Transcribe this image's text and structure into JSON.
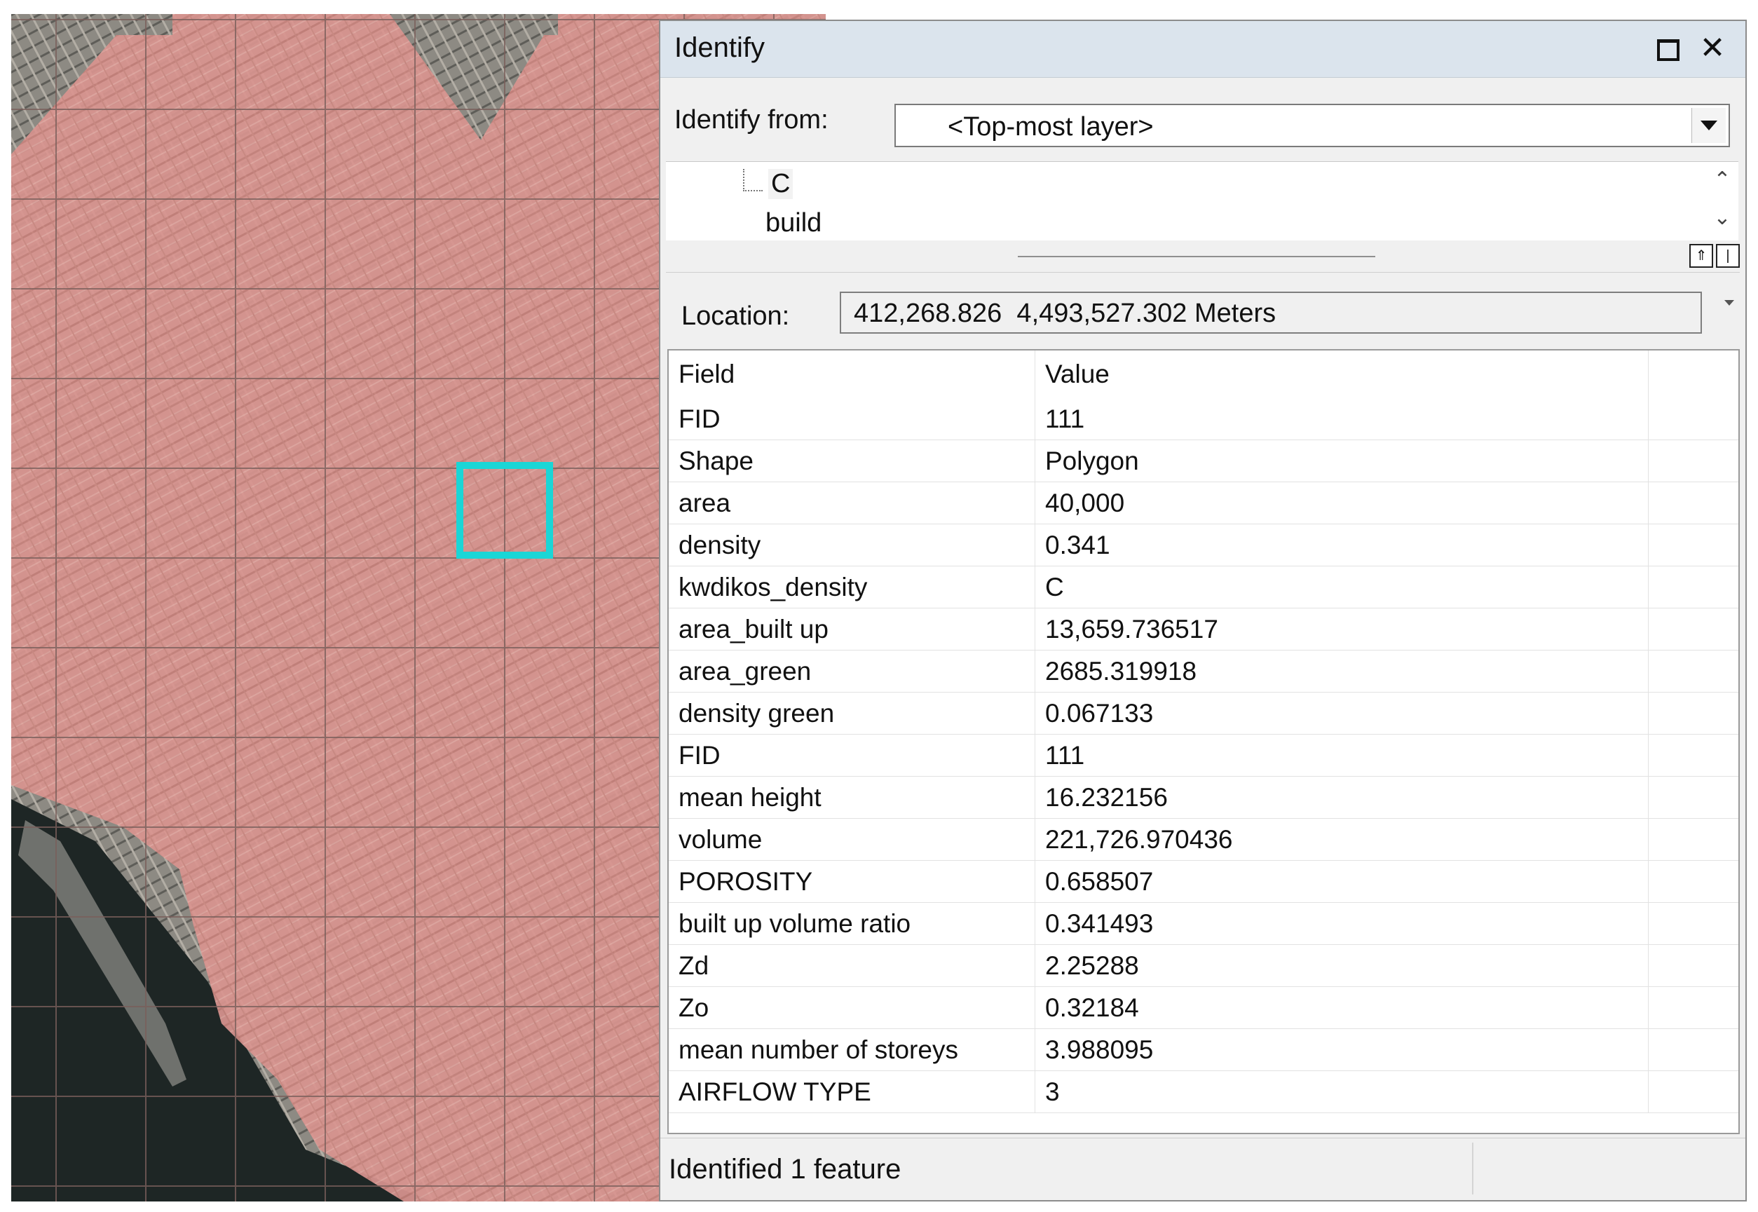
{
  "window": {
    "title": "Identify",
    "close_glyph": "✕",
    "maximize_icon": "maximize-icon",
    "close_icon": "close-icon"
  },
  "identify_from": {
    "label": "Identify from:",
    "value": "<Top-most layer>"
  },
  "tree": {
    "items": [
      "C",
      "build"
    ],
    "scroll_up_glyph": "⌃",
    "scroll_down_glyph": "⌄"
  },
  "mini_buttons": [
    "⇑",
    "|"
  ],
  "location": {
    "label": "Location:",
    "value": "412,268.826  4,493,527.302 Meters"
  },
  "table": {
    "columns": [
      "Field",
      "Value"
    ],
    "rows": [
      {
        "field": "FID",
        "value": "111"
      },
      {
        "field": "Shape",
        "value": "Polygon"
      },
      {
        "field": "area",
        "value": "40,000"
      },
      {
        "field": "density",
        "value": "0.341"
      },
      {
        "field": "kwdikos_density",
        "value": "C"
      },
      {
        "field": "area_built up",
        "value": "13,659.736517"
      },
      {
        "field": "area_green",
        "value": "2685.319918"
      },
      {
        "field": "density green",
        "value": "0.067133"
      },
      {
        "field": "FID",
        "value": "111"
      },
      {
        "field": "mean height",
        "value": "16.232156"
      },
      {
        "field": "volume",
        "value": "221,726.970436"
      },
      {
        "field": "POROSITY",
        "value": "0.658507"
      },
      {
        "field": "built up volume ratio",
        "value": "0.341493"
      },
      {
        "field": "Zd",
        "value": "2.25288"
      },
      {
        "field": "Zo",
        "value": "0.32184"
      },
      {
        "field": "mean number of storeys",
        "value": "3.988095"
      },
      {
        "field": "AIRFLOW TYPE",
        "value": "3"
      }
    ]
  },
  "status": {
    "text": "Identified 1 feature"
  },
  "map": {
    "overlay_color": "#f0a09a",
    "selection_color": "#1ad6d6",
    "sea_color": "#1e2625"
  }
}
